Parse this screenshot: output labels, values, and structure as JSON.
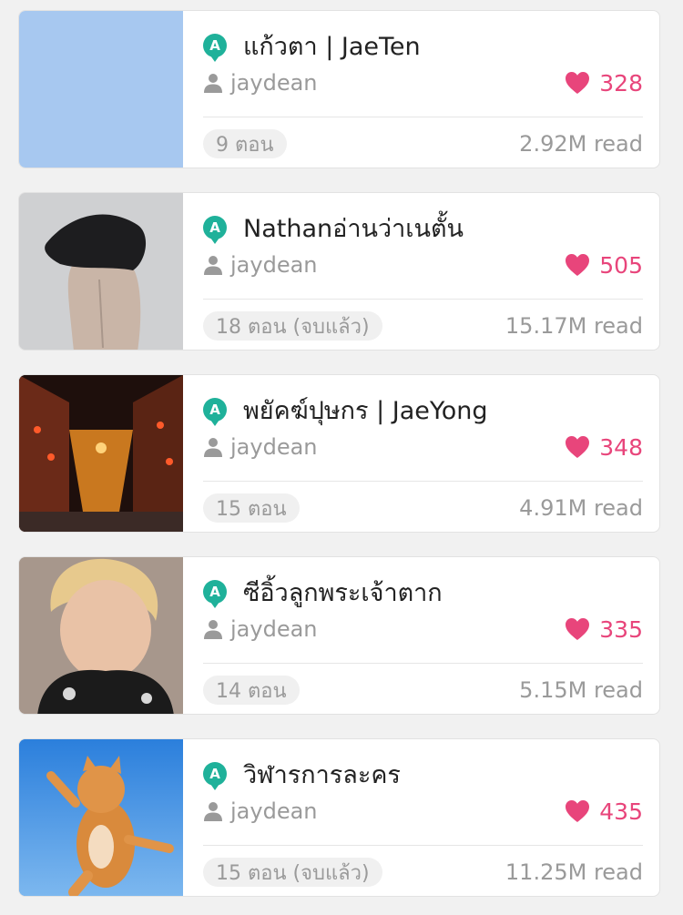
{
  "stories": [
    {
      "title": "แก้วตา | JaeTen",
      "author": "jaydean",
      "likes": "328",
      "episodes": "9 ตอน",
      "reads": "2.92M read",
      "badge": "A",
      "cover": "blank-blue-cover"
    },
    {
      "title": "Nathanอ่านว่าเนตั้น",
      "author": "jaydean",
      "likes": "505",
      "episodes": "18 ตอน (จบแล้ว)",
      "reads": "15.17M read",
      "badge": "A",
      "cover": "photo-person-back"
    },
    {
      "title": "พยัคฆ์ปุษกร | JaeYong",
      "author": "jaydean",
      "likes": "348",
      "episodes": "15 ตอน",
      "reads": "4.91M read",
      "badge": "A",
      "cover": "photo-night-street"
    },
    {
      "title": "ซีอิ้วลูกพระเจ้าตาก",
      "author": "jaydean",
      "likes": "335",
      "episodes": "14 ตอน",
      "reads": "5.15M read",
      "badge": "A",
      "cover": "photo-blond-portrait"
    },
    {
      "title": "วิฬารการละคร",
      "author": "jaydean",
      "likes": "435",
      "episodes": "15 ตอน (จบแล้ว)",
      "reads": "11.25M read",
      "badge": "A",
      "cover": "photo-jumping-cat"
    }
  ],
  "colors": {
    "badge": "#1fb19a",
    "likes": "#e8457b",
    "muted_text": "#9a9a9a"
  },
  "icons": {
    "badge": "a-badge-icon",
    "author": "user-icon",
    "likes": "heart-icon"
  }
}
